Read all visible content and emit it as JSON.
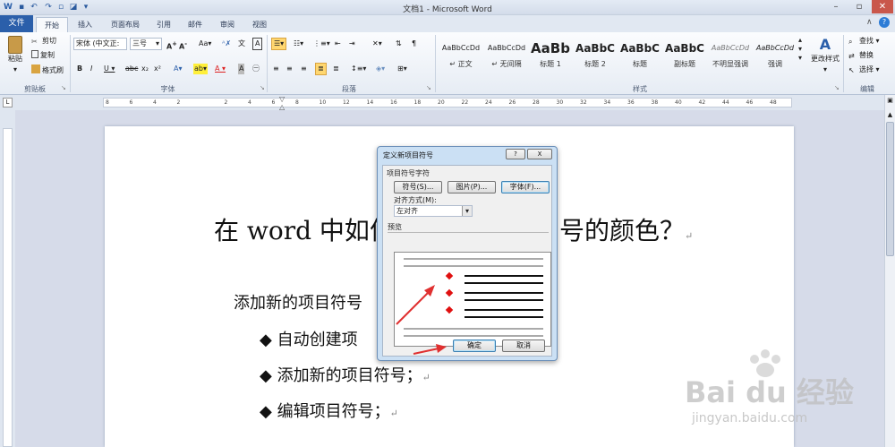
{
  "window": {
    "title": "文档1 - Microsoft Word"
  },
  "tabs": [
    "文件",
    "开始",
    "插入",
    "页面布局",
    "引用",
    "邮件",
    "审阅",
    "视图"
  ],
  "ribbon": {
    "clipboard": {
      "paste": "粘贴",
      "cut": "剪切",
      "copy": "复制",
      "format_painter": "格式刷",
      "label": "剪贴板"
    },
    "font": {
      "font_name": "宋体 (中文正:",
      "font_size": "三号",
      "label": "字体"
    },
    "paragraph": {
      "label": "段落"
    },
    "styles": {
      "items": [
        {
          "preview": "AaBbCcDd",
          "name": "↵ 正文"
        },
        {
          "preview": "AaBbCcDd",
          "name": "↵ 无间隔"
        },
        {
          "preview": "AaBb",
          "name": "标题 1"
        },
        {
          "preview": "AaBbC",
          "name": "标题 2"
        },
        {
          "preview": "AaBbC",
          "name": "标题"
        },
        {
          "preview": "AaBbC",
          "name": "副标题"
        },
        {
          "preview": "AaBbCcDd",
          "name": "不明显强调"
        },
        {
          "preview": "AaBbCcDd",
          "name": "强调"
        }
      ],
      "change": "更改样式",
      "label": "样式"
    },
    "editing": {
      "find": "查找",
      "replace": "替换",
      "select": "选择",
      "label": "编辑"
    }
  },
  "ruler": {
    "numbers": [
      "8",
      "6",
      "4",
      "2",
      "",
      "2",
      "4",
      "6",
      "8",
      "10",
      "12",
      "14",
      "16",
      "18",
      "20",
      "22",
      "24",
      "26",
      "28",
      "30",
      "32",
      "34",
      "36",
      "38",
      "40",
      "42",
      "44",
      "46",
      "48"
    ]
  },
  "document": {
    "heading_left": "在 word 中如何",
    "heading_right": "号的颜色？",
    "subheading": "添加新的项目符号",
    "bullets": [
      "自动创建项",
      "添加新的项目符号；",
      "编辑项目符号；"
    ]
  },
  "dialog": {
    "title": "定义新项目符号",
    "help": "?",
    "close": "X",
    "section": "项目符号字符",
    "symbol_btn": "符号(S)...",
    "picture_btn": "图片(P)...",
    "font_btn": "字体(F)...",
    "align_label": "对齐方式(M):",
    "align_value": "左对齐",
    "preview_label": "预览",
    "ok": "确定",
    "cancel": "取消"
  },
  "watermark": {
    "brand": "Bai du 经验",
    "url": "jingyan.baidu.com"
  },
  "colors": {
    "accent": "#2b5faa",
    "bullet": "#e01010",
    "arrow": "#e03030"
  }
}
